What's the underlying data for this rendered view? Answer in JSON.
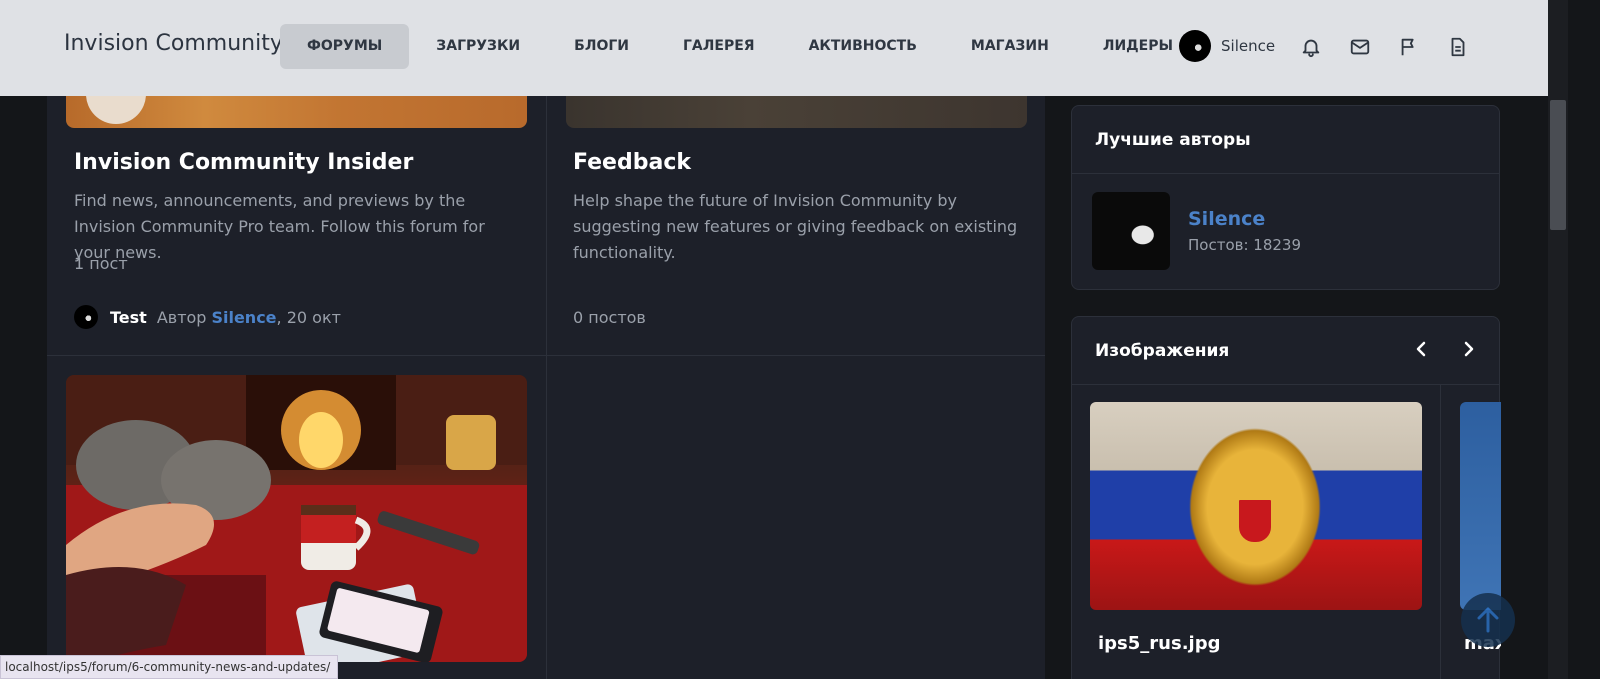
{
  "header": {
    "logo": "Invision Community",
    "nav": [
      "ФОРУМЫ",
      "ЗАГРУЗКИ",
      "БЛОГИ",
      "ГАЛЕРЕЯ",
      "АКТИВНОСТЬ",
      "МАГАЗИН",
      "ЛИДЕРЫ"
    ],
    "active_nav": "ФОРУМЫ",
    "user_name": "Silence",
    "icons": [
      "bell-icon",
      "mail-icon",
      "flag-icon",
      "document-icon"
    ]
  },
  "forums": [
    {
      "title": "Invision Community Insider",
      "description": "Find news, announcements, and previews by the Invision Community Pro team. Follow this forum for your news.",
      "post_count": "1 пост",
      "last_post_title": "Test",
      "last_post_by": "Автор",
      "last_post_author": "Silence",
      "last_post_date": ", 20 окт"
    },
    {
      "title": "Feedback",
      "description": "Help shape the future of Invision Community by suggesting new features or giving feedback on existing functionality.",
      "post_count": "0 постов"
    }
  ],
  "sidebar": {
    "top_authors": {
      "title": "Лучшие авторы",
      "author_name": "Silence",
      "author_posts": "Постов: 18239"
    },
    "gallery": {
      "title": "Изображения",
      "image_name": "ips5_rus.jpg",
      "next_image_name": "max"
    }
  },
  "status_bar_url": "localhost/ips5/forum/6-community-news-and-updates/",
  "colors": {
    "accent": "#4b82c9",
    "header_bg": "#dfe1e5",
    "page_bg": "#141619",
    "card_bg": "#1d2029"
  }
}
